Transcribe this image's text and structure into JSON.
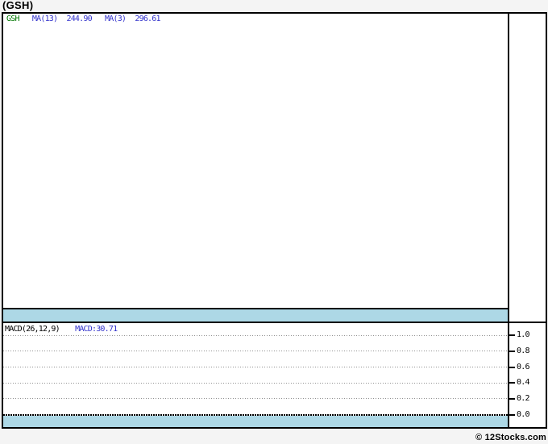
{
  "page": {
    "title": "(GSH)",
    "credit": "© 12Stocks.com"
  },
  "colors": {
    "page_background": "#F4F4F4",
    "panel_background": "#FFFFFF",
    "border": "#000000",
    "band_blue": "#ADD8E6",
    "legend_green": "#007700",
    "legend_blue": "#3333CC",
    "grid_gray": "#909090"
  },
  "main_chart": {
    "legend": [
      {
        "text": "GSH",
        "color": "green"
      },
      {
        "text": "MA(13)",
        "color": "blue"
      },
      {
        "text": "244.90",
        "color": "blue"
      },
      {
        "text": "MA(3)",
        "color": "blue"
      },
      {
        "text": "296.61",
        "color": "blue"
      }
    ]
  },
  "macd_panel": {
    "label": "MACD(26,12,9)",
    "value": "MACD:30.71",
    "axis_ticks": [
      "1.0",
      "0.8",
      "0.6",
      "0.4",
      "0.2",
      "0.0"
    ]
  },
  "chart_data": {
    "type": "line",
    "title": "(GSH)",
    "legend_position": "top-left",
    "panels": [
      {
        "name": "price",
        "series": [
          {
            "name": "GSH",
            "color": "#007700",
            "values": []
          },
          {
            "name": "MA(13)",
            "last_value": 244.9,
            "values": []
          },
          {
            "name": "MA(3)",
            "last_value": 296.61,
            "values": []
          }
        ],
        "note": "plot area rendered empty - no data points visible"
      },
      {
        "name": "MACD",
        "label": "MACD(26,12,9)",
        "last_value": 30.71,
        "ylim": [
          0.0,
          1.0
        ],
        "yticks": [
          1.0,
          0.8,
          0.6,
          0.4,
          0.2,
          0.0
        ],
        "grid": true,
        "values": []
      }
    ]
  }
}
